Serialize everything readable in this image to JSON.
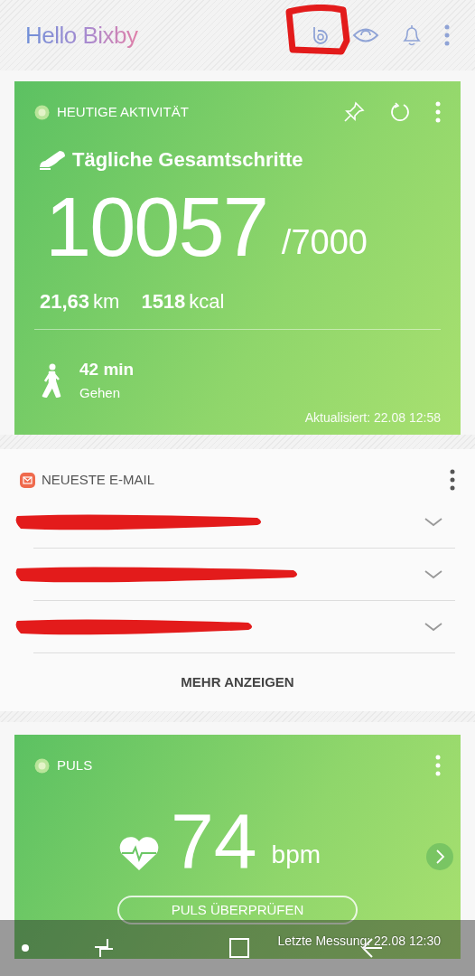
{
  "header": {
    "title": "Hello Bixby"
  },
  "activity_card": {
    "title": "HEUTIGE AKTIVITÄT",
    "steps_label": "Tägliche Gesamtschritte",
    "steps": "10057",
    "goal": "/7000",
    "distance": "21,63",
    "distance_unit": "km",
    "calories": "1518",
    "calories_unit": "kcal",
    "walk_time": "42 min",
    "walk_label": "Gehen",
    "updated": "Aktualisiert: 22.08 12:58"
  },
  "email_card": {
    "title": "NEUESTE E-MAIL",
    "emails": [
      {
        "redacted": true
      },
      {
        "redacted": true
      },
      {
        "redacted": true
      }
    ],
    "more": "MEHR ANZEIGEN"
  },
  "pulse_card": {
    "title": "PULS",
    "value": "74",
    "unit": "bpm",
    "button": "PULS ÜBERPRÜFEN",
    "last": "Letzte Messung: 22.08 12:30"
  }
}
